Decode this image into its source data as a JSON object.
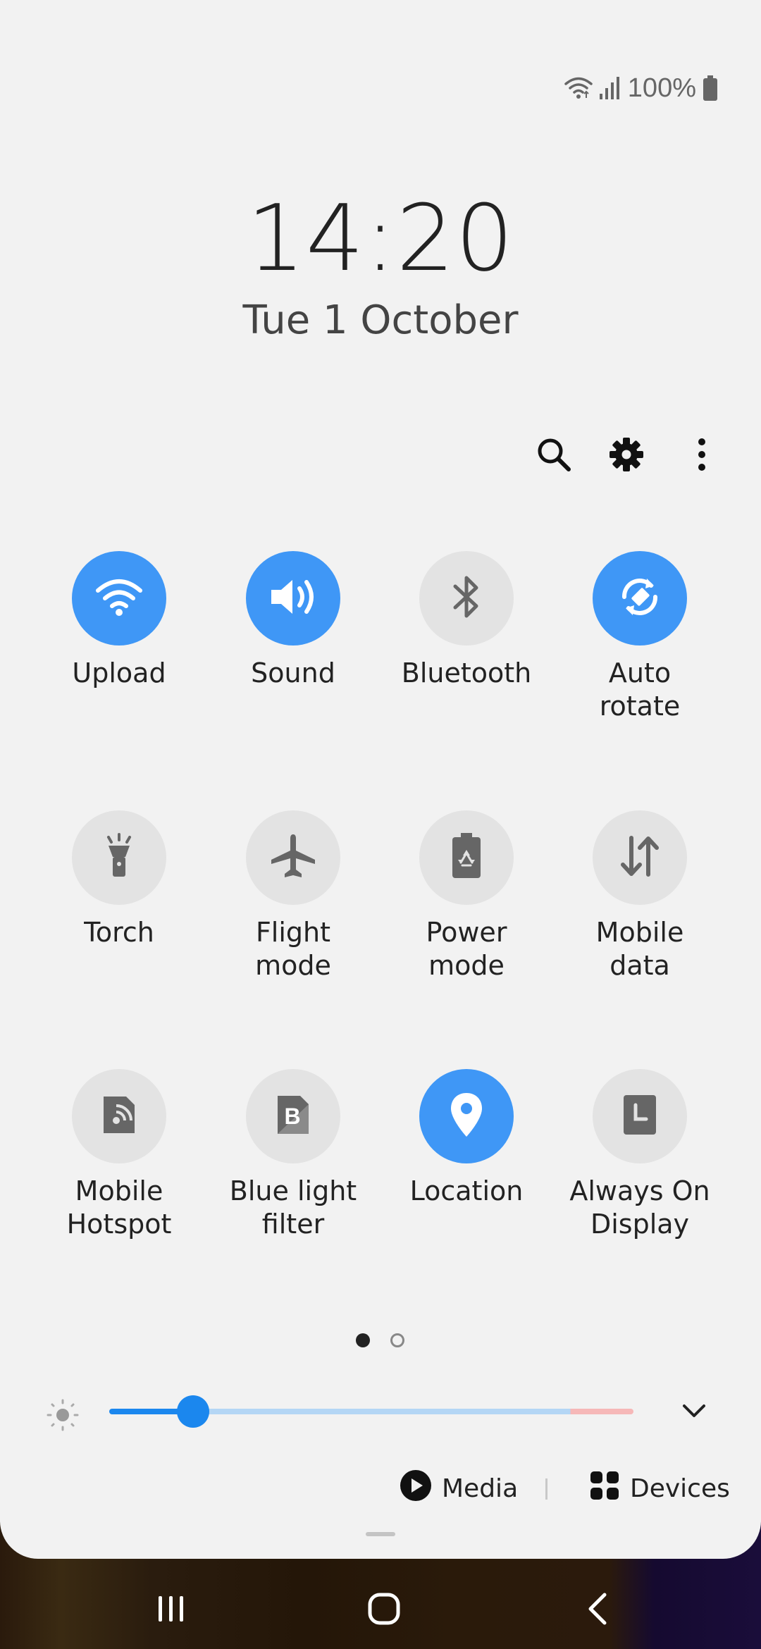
{
  "status_bar": {
    "battery_text": "100%",
    "icons": [
      "wifi-icon",
      "signal-icon",
      "battery-icon"
    ]
  },
  "clock": {
    "time": "14:20",
    "date": "Tue 1 October"
  },
  "toolbar": {
    "icons": [
      "search-icon",
      "settings-icon",
      "more-icon"
    ]
  },
  "tiles": [
    {
      "label": "Upload",
      "icon": "wifi-icon",
      "on": true
    },
    {
      "label": "Sound",
      "icon": "volume-icon",
      "on": true
    },
    {
      "label": "Bluetooth",
      "icon": "bluetooth-icon",
      "on": false
    },
    {
      "label": "Auto\nrotate",
      "icon": "auto-rotate-icon",
      "on": true
    },
    {
      "label": "Torch",
      "icon": "torch-icon",
      "on": false
    },
    {
      "label": "Flight\nmode",
      "icon": "airplane-icon",
      "on": false
    },
    {
      "label": "Power\nmode",
      "icon": "power-mode-icon",
      "on": false
    },
    {
      "label": "Mobile\ndata",
      "icon": "mobile-data-icon",
      "on": false
    },
    {
      "label": "Mobile\nHotspot",
      "icon": "hotspot-icon",
      "on": false
    },
    {
      "label": "Blue light\nfilter",
      "icon": "blue-light-icon",
      "on": false
    },
    {
      "label": "Location",
      "icon": "location-icon",
      "on": true
    },
    {
      "label": "Always On\nDisplay",
      "icon": "always-on-display-icon",
      "on": false
    }
  ],
  "pagination": {
    "current": 1,
    "total": 2
  },
  "brightness": {
    "level": 0.16,
    "icon": "sun-icon"
  },
  "media": {
    "label": "Media",
    "icon": "play-icon"
  },
  "devices": {
    "label": "Devices",
    "icon": "devices-icon"
  },
  "colors": {
    "accent": "#3f97f6",
    "tile_off": "#e3e3e3",
    "panel_bg": "#f2f2f2",
    "slider_fill": "#1b87ee"
  },
  "nav_bar": {
    "icons": [
      "recents-icon",
      "home-icon",
      "back-icon"
    ]
  }
}
